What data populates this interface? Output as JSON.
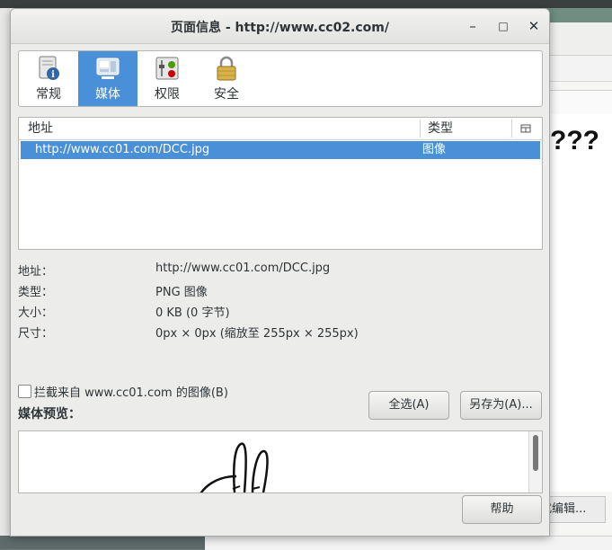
{
  "dialog": {
    "title": "页面信息 - http://www.cc02.com/",
    "window_buttons": {
      "minimize": "–",
      "maximize": "□",
      "close": "✕"
    }
  },
  "tabs": [
    {
      "label": "常规",
      "icon": "info-icon",
      "active": false
    },
    {
      "label": "媒体",
      "icon": "media-icon",
      "active": true
    },
    {
      "label": "权限",
      "icon": "permissions-icon",
      "active": false
    },
    {
      "label": "安全",
      "icon": "lock-icon",
      "active": false
    }
  ],
  "media_table": {
    "columns": [
      "地址",
      "类型"
    ],
    "rows": [
      {
        "address": "http://www.cc01.com/DCC.jpg",
        "type": "图像",
        "selected": true
      }
    ]
  },
  "details": {
    "address_label": "地址：",
    "address_value": "http://www.cc01.com/DCC.jpg",
    "type_label": "类型：",
    "type_value": "PNG 图像",
    "size_label": "大小：",
    "size_value": "0 KB (0 字节)",
    "dimensions_label": "尺寸：",
    "dimensions_value": "0px × 0px (缩放至 255px × 255px)"
  },
  "block_checkbox_label": "拦截来自 www.cc01.com 的图像(B)",
  "media_preview_label": "媒体预览：",
  "buttons": {
    "select_all": "全选(A)",
    "save_as": "另存为(A)...",
    "help": "帮助"
  },
  "background": {
    "heading": "???",
    "edit_button": "式编辑..."
  },
  "colors": {
    "accent": "#4a90d9",
    "dialog_bg": "#ececeb",
    "text": "#2e3436"
  }
}
